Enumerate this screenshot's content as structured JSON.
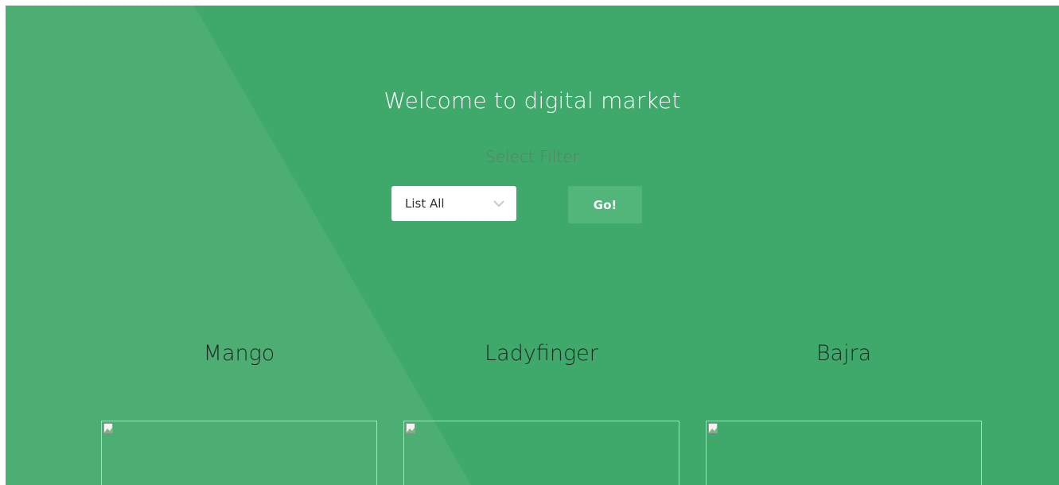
{
  "header": {
    "title": "Welcome to digital market",
    "filter_label": "Select Filter"
  },
  "filter": {
    "selected": "List All",
    "go_label": "Go!"
  },
  "products": [
    {
      "name": "Mango"
    },
    {
      "name": "Ladyfinger"
    },
    {
      "name": "Bajra"
    }
  ],
  "colors": {
    "background": "#3ea96b",
    "diagonal_overlay": "#4cad73",
    "button": "#52b579",
    "select_bg": "#ffffff",
    "title_text": "#ffffff",
    "product_text": "#1f2a24"
  },
  "icons": {
    "select_arrow": "chevron-down-icon",
    "card_placeholder": "broken-image-icon"
  }
}
